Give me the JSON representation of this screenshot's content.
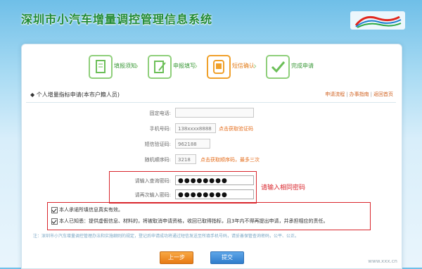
{
  "header": {
    "title": "深圳市小汽车增量调控管理信息系统"
  },
  "steps": [
    {
      "label": "填报须知"
    },
    {
      "label": "申报填写"
    },
    {
      "label": "短信确认"
    },
    {
      "label": "完成申请"
    }
  ],
  "section": {
    "title": "个人增量指标申请(本市户籍人员)",
    "links": [
      "申请流程",
      "办事指南",
      "返回首页"
    ]
  },
  "form": {
    "phone_label": "固定电话:",
    "phone_value": "",
    "mobile_label": "手机号码:",
    "mobile_value": "138xxxx8888",
    "mobile_link": "点击获取验证码",
    "sms_label": "短信验证码:",
    "sms_value": "962188",
    "random_label": "随机顺序码:",
    "random_value": "3218",
    "random_link": "点击获取顺序码，最多三次",
    "pwd_label": "请输入查询密码:",
    "pwd_value": "●●●●●●●●",
    "pwd2_label": "请再次输入密码:",
    "pwd2_value": "●●●●●●●●"
  },
  "annotation": {
    "note": "请输入相同密码"
  },
  "checks": {
    "c1": "本人承诺所填信息真实有效。",
    "c2": "本人已知悉：提供虚假信息、材料的，将被取消申请资格，收回已取得指标，且3年内不得再提出申请，并承担相应的责任。"
  },
  "notice": "注：深圳市小汽车增量调控管理办法和实施细则的规定，登记后申请成功将通过短信发送至所填手机号码，请妥善保管查询密码，公平、公正。",
  "buttons": {
    "prev": "上一步",
    "submit": "提交"
  },
  "watermark": "www.xxx.cn"
}
